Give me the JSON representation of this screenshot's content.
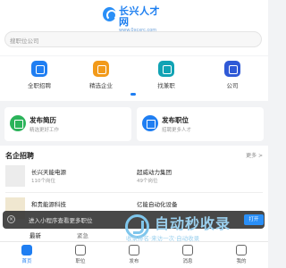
{
  "header": {
    "logo_title": "长兴人才网",
    "logo_url": "www.0xcxrc.com",
    "search_placeholder": "搜职位公司"
  },
  "shortcuts": [
    {
      "label": "全职招聘",
      "icon": "briefcase-icon",
      "color": "#1f7ef2"
    },
    {
      "label": "精选企业",
      "icon": "building-icon",
      "color": "#f29a1a"
    },
    {
      "label": "找兼职",
      "icon": "clock-icon",
      "color": "#11a3b4"
    },
    {
      "label": "公司",
      "icon": "person-icon",
      "color": "#2f59d6"
    }
  ],
  "post_cards": {
    "resume": {
      "title": "发布简历",
      "sub": "精选更好工作"
    },
    "job": {
      "title": "发布职位",
      "sub": "招聘更多人才"
    }
  },
  "famous": {
    "title": "名企招聘",
    "more": "更多 >",
    "companies": [
      {
        "name": "长兴天能电源",
        "count": "110个岗位"
      },
      {
        "name": "超威动力集团",
        "count": "49个岗位"
      },
      {
        "name": "和贵能源科技",
        "count": ""
      },
      {
        "name": "亿能自动化设备",
        "count": ""
      }
    ],
    "tabs": [
      "最新",
      "紧急"
    ]
  },
  "toast": {
    "text": "进入小程序查看更多职位",
    "button": "打开"
  },
  "watermark": {
    "title": "自动秒收录",
    "sub": "收录排名·来访一次·自动收录"
  },
  "tabbar": [
    {
      "label": "首页",
      "active": true
    },
    {
      "label": "职位",
      "active": false
    },
    {
      "label": "发布",
      "active": false
    },
    {
      "label": "消息",
      "active": false
    },
    {
      "label": "我的",
      "active": false
    }
  ]
}
